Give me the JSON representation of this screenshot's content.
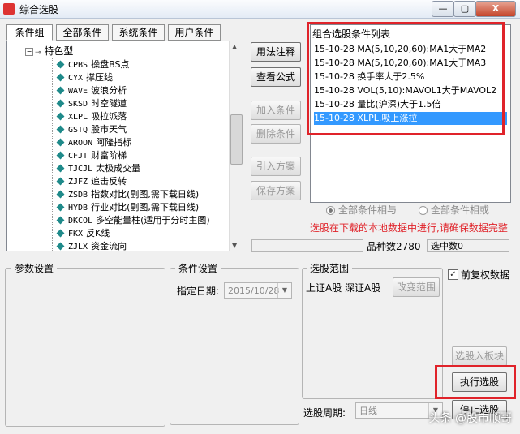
{
  "window": {
    "title": "综合选股",
    "min_label": "—",
    "max_label": "▢",
    "close_label": "X"
  },
  "tabs": [
    {
      "label": "条件组",
      "active": true
    },
    {
      "label": "全部条件",
      "active": false
    },
    {
      "label": "系统条件",
      "active": false
    },
    {
      "label": "用户条件",
      "active": false
    }
  ],
  "tree": {
    "root_label": "特色型",
    "items": [
      {
        "code": "CPBS",
        "name": "操盘BS点"
      },
      {
        "code": "CYX",
        "name": "撑压线"
      },
      {
        "code": "WAVE",
        "name": "波浪分析"
      },
      {
        "code": "SKSD",
        "name": "时空隧道"
      },
      {
        "code": "XLPL",
        "name": "吸拉派落"
      },
      {
        "code": "GSTQ",
        "name": "股市天气"
      },
      {
        "code": "AROON",
        "name": "阿隆指标"
      },
      {
        "code": "CFJT",
        "name": "财富阶梯"
      },
      {
        "code": "TJCJL",
        "name": "太极成交量"
      },
      {
        "code": "ZJFZ",
        "name": "追击反转"
      },
      {
        "code": "ZSDB",
        "name": "指数对比(副图,需下载日线)"
      },
      {
        "code": "HYDB",
        "name": "行业对比(副图,需下载日线)"
      },
      {
        "code": "DKCOL",
        "name": "多空能量柱(适用于分时主图)"
      },
      {
        "code": "FKX",
        "name": "反K线"
      },
      {
        "code": "ZJLX",
        "name": "资金流向"
      }
    ]
  },
  "buttons": {
    "usage": "用法注释",
    "view_formula": "查看公式",
    "add_condition": "加入条件",
    "delete_condition": "删除条件",
    "import_plan": "引入方案",
    "save_plan": "保存方案",
    "add_to_board": "选股入板块",
    "execute": "执行选股",
    "stop": "停止选股",
    "change_range": "改变范围"
  },
  "condition_list": {
    "title": "组合选股条件列表",
    "items": [
      {
        "text": "15-10-28 MA(5,10,20,60):MA1大于MA2",
        "selected": false
      },
      {
        "text": "15-10-28 MA(5,10,20,60):MA1大于MA3",
        "selected": false
      },
      {
        "text": "15-10-28 换手率大于2.5%",
        "selected": false
      },
      {
        "text": "15-10-28 VOL(5,10):MAVOL1大于MAVOL2",
        "selected": false
      },
      {
        "text": "15-10-28 量比(沪深)大于1.5倍",
        "selected": false
      },
      {
        "text": "15-10-28 XLPL.吸上涨拉",
        "selected": true
      }
    ]
  },
  "logic": {
    "all_and": "全部条件相与",
    "all_or": "全部条件相或",
    "selected": "all_and"
  },
  "warning": "选股在下载的本地数据中进行,请确保数据完整",
  "stats": {
    "varieties_label": "品种数",
    "varieties_value": "2780",
    "selected_label": "选中数",
    "selected_value": "0"
  },
  "params": {
    "legend": "参数设置"
  },
  "conditions": {
    "legend": "条件设置",
    "date_label": "指定日期:",
    "date_value": "2015/10/28"
  },
  "range": {
    "legend": "选股范围",
    "value": "上证A股 深证A股"
  },
  "options": {
    "adjusted_label": "前复权数据",
    "adjusted_checked": true
  },
  "period": {
    "label": "选股周期:",
    "value": "日线"
  },
  "watermark": "头条 @股市顺哥",
  "colors": {
    "accent_red": "#e0232a",
    "selection_blue": "#3399ff"
  }
}
